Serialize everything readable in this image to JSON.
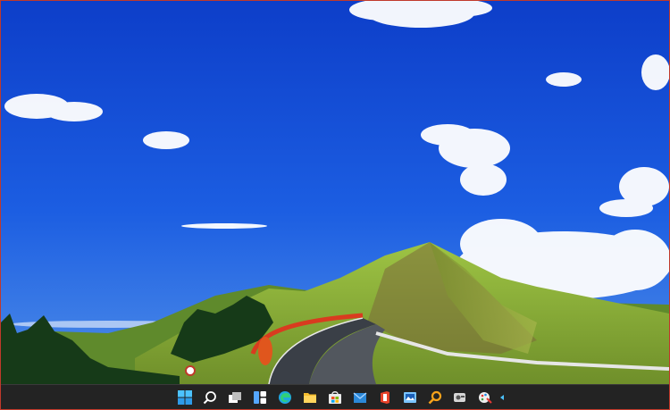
{
  "desktop": {
    "wallpaper": "mountain-road-blue-sky",
    "sky_color": "#1f56d8",
    "grass_color": "#8fb23a"
  },
  "taskbar": {
    "background": "#232323",
    "items": [
      {
        "icon": "start-windows-icon"
      },
      {
        "icon": "search-icon"
      },
      {
        "icon": "task-view-icon"
      },
      {
        "icon": "widgets-icon"
      },
      {
        "icon": "edge-browser-icon"
      },
      {
        "icon": "file-explorer-icon"
      },
      {
        "icon": "microsoft-store-icon"
      },
      {
        "icon": "mail-icon"
      },
      {
        "icon": "office-icon"
      },
      {
        "icon": "photos-app-icon"
      },
      {
        "icon": "magnifier-icon"
      },
      {
        "icon": "app-icon"
      },
      {
        "icon": "paint-icon"
      }
    ],
    "tray": {
      "icon": "notification-icon"
    }
  }
}
